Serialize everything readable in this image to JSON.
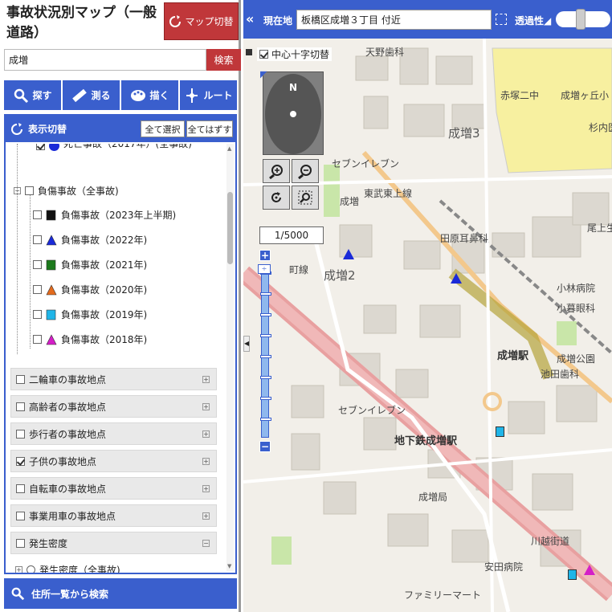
{
  "app": {
    "title": "事故状況別マップ（一般道路）",
    "map_switch_label": "マップ切替"
  },
  "search": {
    "value": "成増",
    "button_label": "検索"
  },
  "tools": [
    {
      "label": "探す",
      "icon": "search-icon"
    },
    {
      "label": "測る",
      "icon": "ruler-icon"
    },
    {
      "label": "描く",
      "icon": "palette-icon"
    },
    {
      "label": "ルート",
      "icon": "route-icon"
    }
  ],
  "panel": {
    "title": "表示切替",
    "select_all_label": "全て選択",
    "clear_all_label": "全てはずす",
    "tree": {
      "partial_label": "死亡事故（2017年）(全事故)",
      "injury_group_label": "負傷事故（全事故)",
      "injury_items": [
        {
          "label": "負傷事故（2023年上半期)",
          "marker": "square",
          "color": "#111111"
        },
        {
          "label": "負傷事故（2022年)",
          "marker": "triangle",
          "color": "#1a2ad8"
        },
        {
          "label": "負傷事故（2021年)",
          "marker": "square",
          "color": "#1c7a1c"
        },
        {
          "label": "負傷事故（2020年)",
          "marker": "triangle",
          "color": "#e36b1d"
        },
        {
          "label": "負傷事故（2019年)",
          "marker": "square",
          "color": "#20b5e8"
        },
        {
          "label": "負傷事故（2018年)",
          "marker": "triangle",
          "color": "#d41ec7"
        }
      ],
      "groups": [
        {
          "label": "二輪車の事故地点",
          "checked": false,
          "expander": "+"
        },
        {
          "label": "高齢者の事故地点",
          "checked": false,
          "expander": "+"
        },
        {
          "label": "歩行者の事故地点",
          "checked": false,
          "expander": "+"
        },
        {
          "label": "子供の事故地点",
          "checked": true,
          "expander": "+"
        },
        {
          "label": "自転車の事故地点",
          "checked": false,
          "expander": "+"
        },
        {
          "label": "事業用車の事故地点",
          "checked": false,
          "expander": "+"
        },
        {
          "label": "発生密度",
          "checked": false,
          "expander": "−"
        }
      ],
      "density_child_label": "発生密度（全事故)"
    }
  },
  "address_search_label": "住所一覧から検索",
  "map": {
    "collapse_label": "«",
    "current_location_label": "現在地",
    "current_location_value": "板橋区成増３丁目 付近",
    "transparency_label": "透過性◢",
    "transparency_level": 0.45,
    "crosshair_label": "中心十字切替",
    "crosshair_checked": true,
    "compass_label": "N",
    "scale_value": "1/5000",
    "zoom_in_label": "+",
    "zoom_out_label": "−",
    "labels": [
      {
        "text": "天野歯科",
        "kind": "poi"
      },
      {
        "text": "成増3",
        "kind": "area"
      },
      {
        "text": "赤塚二中",
        "kind": "poi"
      },
      {
        "text": "成増ヶ丘小",
        "kind": "poi"
      },
      {
        "text": "杉内医",
        "kind": "poi"
      },
      {
        "text": "セブンイレブン",
        "kind": "poi"
      },
      {
        "text": "東武東上線",
        "kind": "rail"
      },
      {
        "text": "成増",
        "kind": "poi"
      },
      {
        "text": "田原耳鼻科",
        "kind": "poi"
      },
      {
        "text": "尾上生",
        "kind": "poi"
      },
      {
        "text": "成増2",
        "kind": "area"
      },
      {
        "text": "町線",
        "kind": "road"
      },
      {
        "text": "小林病院",
        "kind": "poi"
      },
      {
        "text": "小暮眼科",
        "kind": "poi"
      },
      {
        "text": "成増公園",
        "kind": "poi"
      },
      {
        "text": "成増駅",
        "kind": "station"
      },
      {
        "text": "池田歯科",
        "kind": "poi"
      },
      {
        "text": "セブンイレブン",
        "kind": "poi"
      },
      {
        "text": "地下鉄成増駅",
        "kind": "station"
      },
      {
        "text": "成増局",
        "kind": "poi"
      },
      {
        "text": "川越街道",
        "kind": "road"
      },
      {
        "text": "安田病院",
        "kind": "poi"
      },
      {
        "text": "ファミリーマート",
        "kind": "poi"
      }
    ]
  }
}
